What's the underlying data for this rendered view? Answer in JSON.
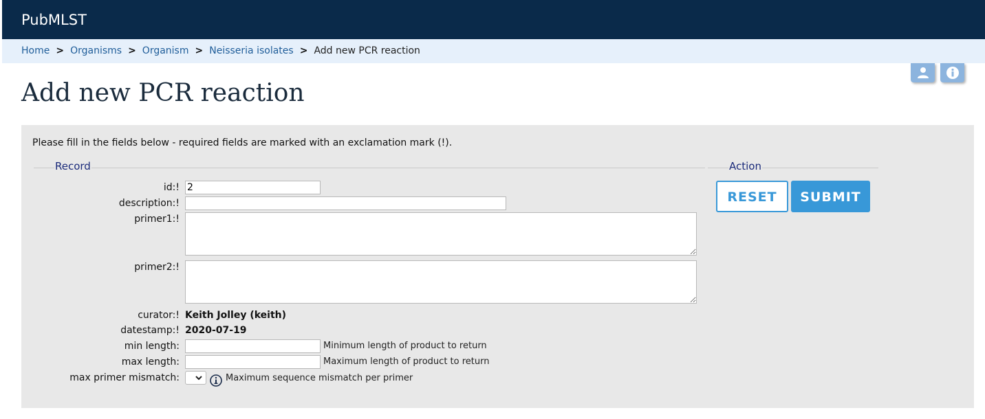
{
  "header": {
    "brand": "PubMLST"
  },
  "breadcrumb": {
    "items": [
      "Home",
      "Organisms",
      "Organism",
      "Neisseria isolates"
    ],
    "current": "Add new PCR reaction",
    "separator": ">"
  },
  "page": {
    "title": "Add new PCR reaction"
  },
  "form": {
    "instructions": "Please fill in the fields below - required fields are marked with an exclamation mark (!).",
    "record_legend": "Record",
    "action_legend": "Action",
    "fields": {
      "id": {
        "label": "id:!",
        "value": "2"
      },
      "description": {
        "label": "description:!",
        "value": ""
      },
      "primer1": {
        "label": "primer1:!",
        "value": ""
      },
      "primer2": {
        "label": "primer2:!",
        "value": ""
      },
      "curator": {
        "label": "curator:!",
        "value": "Keith Jolley (keith)"
      },
      "datestamp": {
        "label": "datestamp:!",
        "value": "2020-07-19"
      },
      "min_length": {
        "label": "min length:",
        "value": "",
        "hint": "Minimum length of product to return"
      },
      "max_length": {
        "label": "max length:",
        "value": "",
        "hint": "Maximum length of product to return"
      },
      "max_primer_mismatch": {
        "label": "max primer mismatch:",
        "value": "",
        "hint": "Maximum sequence mismatch per primer"
      }
    },
    "buttons": {
      "reset": "RESET",
      "submit": "SUBMIT"
    }
  },
  "icons": {
    "user": "user-icon",
    "info": "info-icon",
    "tooltip": "info-circle-icon"
  },
  "colors": {
    "topbar": "#0a2a4a",
    "breadcrumb_bg": "#e6f0fb",
    "link": "#1f5d99",
    "panel_bg": "#e8e8e8",
    "accent": "#3898d8",
    "legend": "#1a2a7a"
  }
}
